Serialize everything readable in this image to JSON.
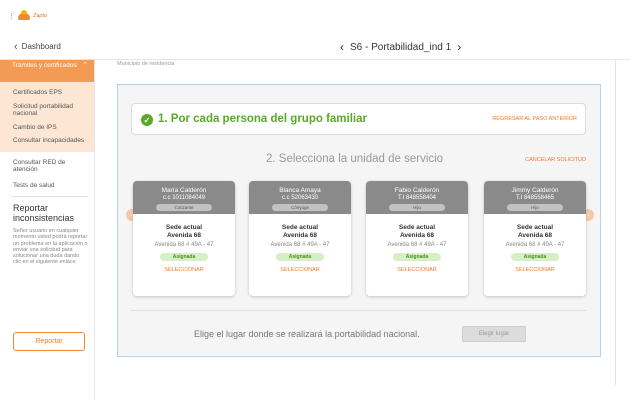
{
  "app": {
    "logo_text": "Zapto"
  },
  "header": {
    "back_label": "Dashboard",
    "title": "S6 - Portabilidad_ind 1"
  },
  "sidebar": {
    "active_section": "Trámites y certificados",
    "items": [
      {
        "label": "Certificados EPS"
      },
      {
        "label": "Solicitud portabilidad nacional"
      },
      {
        "label": "Cambio de IPS"
      },
      {
        "label": "Consultar incapacidades"
      }
    ],
    "extra_items": [
      {
        "label": "Consultar RED de atención"
      },
      {
        "label": "Tests de salud"
      }
    ],
    "report": {
      "title": "Reportar inconsistencias",
      "text": "Señor usuario en cualquier momento usted podrá reportar un problema en la aplicación o enviar una solicitud para solucionar una duda dando clic en el siguiente enlace",
      "button_label": "Reportar"
    }
  },
  "content": {
    "residence_label": "Municipio de residencia",
    "step1": {
      "title": "1. Por cada persona del grupo familiar",
      "back_label": "REGRESAR AL PASO ANTERIOR"
    },
    "step2": {
      "title": "2. Selecciona la unidad de servicio",
      "cancel_label": "CANCELAR SOLICITUD"
    },
    "cards": [
      {
        "name": "María Calderón",
        "id": "c.c 1011084049",
        "role": "Cotizante",
        "sede": "Sede actual",
        "avenue": "Avenida 68",
        "address": "Avenida 68 # 49A - 47",
        "status": "Asignada",
        "select": "SELECCIONAR"
      },
      {
        "name": "Blanca Amaya",
        "id": "c.c 52063430",
        "role": "Cónyuge",
        "sede": "Sede actual",
        "avenue": "Avenida 68",
        "address": "Avenida 68 # 49A - 47",
        "status": "Asignada",
        "select": "SELECCIONAR"
      },
      {
        "name": "Fabio Calderón",
        "id": "T.I 848558404",
        "role": "Hijo",
        "sede": "Sede actual",
        "avenue": "Avenida 68",
        "address": "Avenida 68 # 49A - 47",
        "status": "Asignada",
        "select": "SELECCIONAR"
      },
      {
        "name": "Jimmy Calderón",
        "id": "T.I 848558465",
        "role": "Hijo",
        "sede": "Sede actual",
        "avenue": "Avenida 68",
        "address": "Avenida 68 # 49A - 47",
        "status": "Asignada",
        "select": "SELECCIONAR"
      }
    ],
    "footer": {
      "text": "Elige el lugar donde se realizará la portabilidad nacional.",
      "button_label": "Elegir lugar"
    }
  },
  "colors": {
    "accent": "#ef7a2a",
    "success": "#5aa92b",
    "panel_border": "#b9d3ea"
  }
}
